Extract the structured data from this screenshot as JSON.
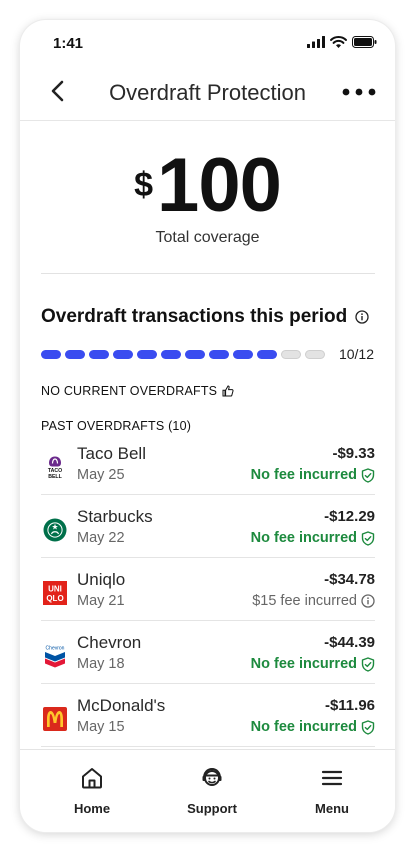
{
  "status": {
    "time": "1:41"
  },
  "header": {
    "title": "Overdraft Protection"
  },
  "coverage": {
    "currency": "$",
    "amount": "100",
    "label": "Total coverage"
  },
  "transactions_section": {
    "title": "Overdraft transactions this period",
    "progress": {
      "used": 10,
      "total": 12,
      "label": "10/12"
    },
    "no_current_label": "NO CURRENT OVERDRAFTS",
    "past_label": "PAST OVERDRAFTS (10)"
  },
  "transactions": [
    {
      "name": "Taco Bell",
      "date": "May 25",
      "amount": "-$9.33",
      "fee": "No fee incurred",
      "fee_status": "ok",
      "icon": "taco-bell-logo"
    },
    {
      "name": "Starbucks",
      "date": "May 22",
      "amount": "-$12.29",
      "fee": "No fee incurred",
      "fee_status": "ok",
      "icon": "starbucks-logo"
    },
    {
      "name": "Uniqlo",
      "date": "May 21",
      "amount": "-$34.78",
      "fee": "$15 fee incurred",
      "fee_status": "charged",
      "icon": "uniqlo-logo"
    },
    {
      "name": "Chevron",
      "date": "May 18",
      "amount": "-$44.39",
      "fee": "No fee incurred",
      "fee_status": "ok",
      "icon": "chevron-logo"
    },
    {
      "name": "McDonald's",
      "date": "May 15",
      "amount": "-$11.96",
      "fee": "No fee incurred",
      "fee_status": "ok",
      "icon": "mcdonalds-logo"
    }
  ],
  "nav": {
    "home": "Home",
    "support": "Support",
    "menu": "Menu"
  },
  "colors": {
    "accent": "#3a4cf0",
    "success": "#1d8a3e",
    "muted": "#666666"
  }
}
